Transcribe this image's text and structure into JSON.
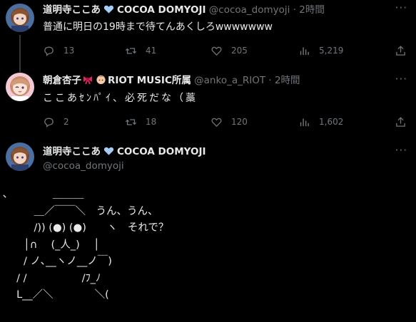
{
  "tweets": [
    {
      "name": "道明寺ここあ",
      "display_suffix": "COCOA DOMYOJI",
      "handle": "@cocoa_domyoji",
      "time": "· 2時間",
      "text": "普通に明日の19時まで待てんあくしろwwwwwww",
      "replies": "13",
      "retweets": "41",
      "likes": "205",
      "views": "5,219"
    },
    {
      "name": "朝倉杏子",
      "display_suffix": "RIOT MUSIC所属",
      "handle": "@anko_a_RIOT",
      "time": "· 2時間",
      "text": "ここあｾﾝﾊﾟｲ、必死だな（藁",
      "replies": "2",
      "retweets": "18",
      "likes": "120",
      "views": "1,602"
    }
  ],
  "main_tweet": {
    "name": "道明寺ここあ",
    "display_suffix": "COCOA DOMYOJI",
    "handle": "@cocoa_domyoji",
    "ascii_art": "､　　　　 ＿＿＿\n　　　＿／￣￣＼　うん、うん、\n　　　/)) (●) (●)　　ヽ　それで？\n　　│∩　 (_人_)　 │\n　　/ ノ､__ヽノ__ノ￣)\n　 / /　　　　　 /ﾌ_ﾉ\n　 L__／＼　　　　＼("
  },
  "icons": {
    "verified": "verified-badge-icon",
    "more": "more-dots-icon",
    "reply": "reply-icon",
    "retweet": "retweet-icon",
    "like": "heart-icon",
    "views": "views-chart-icon",
    "share": "share-icon"
  },
  "colors": {
    "background": "#000000",
    "text": "#e7e9ea",
    "muted": "#71767b",
    "verified": "#a6cdf7"
  }
}
